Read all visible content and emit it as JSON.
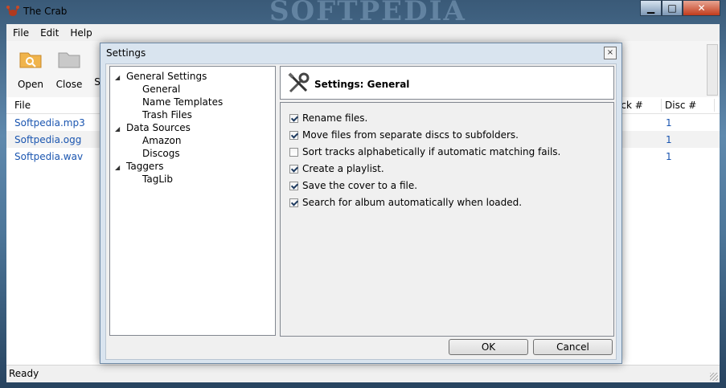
{
  "window": {
    "title": "The Crab",
    "watermark": "SOFTPEDIA"
  },
  "menu": [
    "File",
    "Edit",
    "Help"
  ],
  "toolbar": {
    "open": "Open",
    "close": "Close",
    "partial": "S"
  },
  "table": {
    "col_file": "File",
    "col_track": "ack #",
    "col_disc": "Disc #"
  },
  "rows": [
    {
      "file": "Softpedia.mp3",
      "disc": "1"
    },
    {
      "file": "Softpedia.ogg",
      "disc": "1"
    },
    {
      "file": "Softpedia.wav",
      "disc": "1"
    }
  ],
  "status": "Ready",
  "dialog": {
    "title": "Settings",
    "close": "×",
    "tree": {
      "general_settings": "General Settings",
      "general": "General",
      "name_templates": "Name Templates",
      "trash_files": "Trash Files",
      "data_sources": "Data Sources",
      "amazon": "Amazon",
      "discogs": "Discogs",
      "taggers": "Taggers",
      "taglib": "TagLib"
    },
    "header": "Settings: General",
    "options": [
      {
        "label": "Rename files.",
        "checked": true
      },
      {
        "label": "Move files from separate discs to subfolders.",
        "checked": true
      },
      {
        "label": "Sort tracks alphabetically if automatic matching fails.",
        "checked": false
      },
      {
        "label": "Create a playlist.",
        "checked": true
      },
      {
        "label": "Save the cover to a file.",
        "checked": true
      },
      {
        "label": "Search for album automatically when loaded.",
        "checked": true
      }
    ],
    "ok": "OK",
    "cancel": "Cancel"
  }
}
